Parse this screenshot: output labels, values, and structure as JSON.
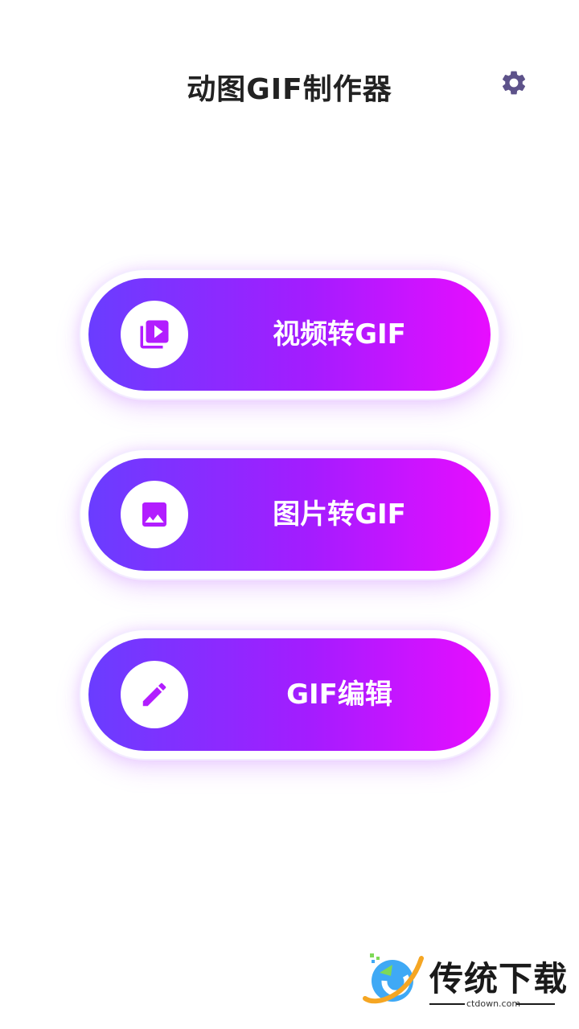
{
  "header": {
    "title": "动图GIF制作器",
    "settings_icon": "gear-icon"
  },
  "menu": {
    "buttons": [
      {
        "label": "视频转GIF",
        "icon": "video-library-icon"
      },
      {
        "label": "图片转GIF",
        "icon": "image-icon"
      },
      {
        "label": "GIF编辑",
        "icon": "pencil-icon"
      }
    ]
  },
  "watermark": {
    "brand": "传统下载",
    "domain": "ctdown.com"
  },
  "colors": {
    "gradient_start": "#6a3dff",
    "gradient_end": "#e80dff",
    "gear": "#5d528a",
    "icon": "#b21dff"
  }
}
